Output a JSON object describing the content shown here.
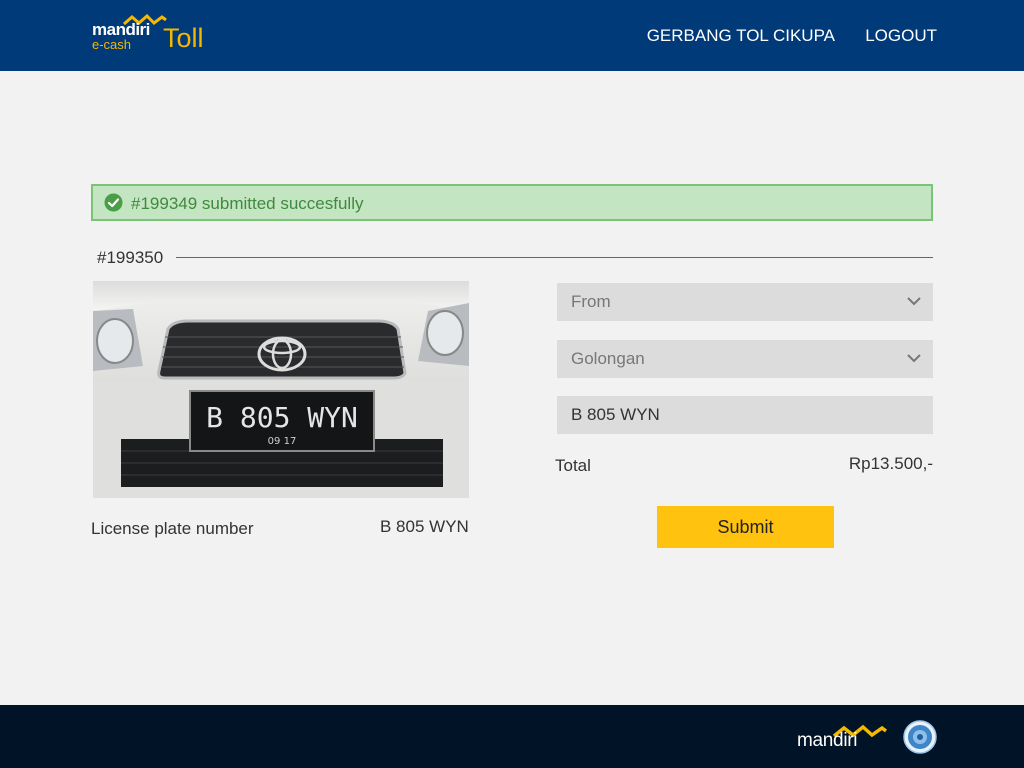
{
  "header": {
    "brand_mandiri": "mandiri",
    "brand_ecash": "e-cash",
    "brand_toll": "Toll",
    "gate_name": "GERBANG TOL CIKUPA",
    "logout_label": "LOGOUT"
  },
  "alert": {
    "icon": "check-circle-icon",
    "message": "#199349 submitted succesfully",
    "color": "#3f8a3e"
  },
  "transaction": {
    "id": "#199350",
    "plate_label": "License plate number",
    "plate_value": "B 805 WYN"
  },
  "form": {
    "from_placeholder": "From",
    "golongan_placeholder": "Golongan",
    "plate_input_value": "B 805 WYN",
    "total_label": "Total",
    "total_value": "Rp13.500,-",
    "submit_label": "Submit"
  },
  "photo": {
    "plate_text": "B  805  WYN",
    "plate_expiry": "09  17"
  },
  "footer": {
    "brand": "mandiri"
  },
  "colors": {
    "header_bg": "#003a78",
    "accent": "#f5b800",
    "submit": "#ffc20e",
    "footer_bg": "#011326"
  }
}
